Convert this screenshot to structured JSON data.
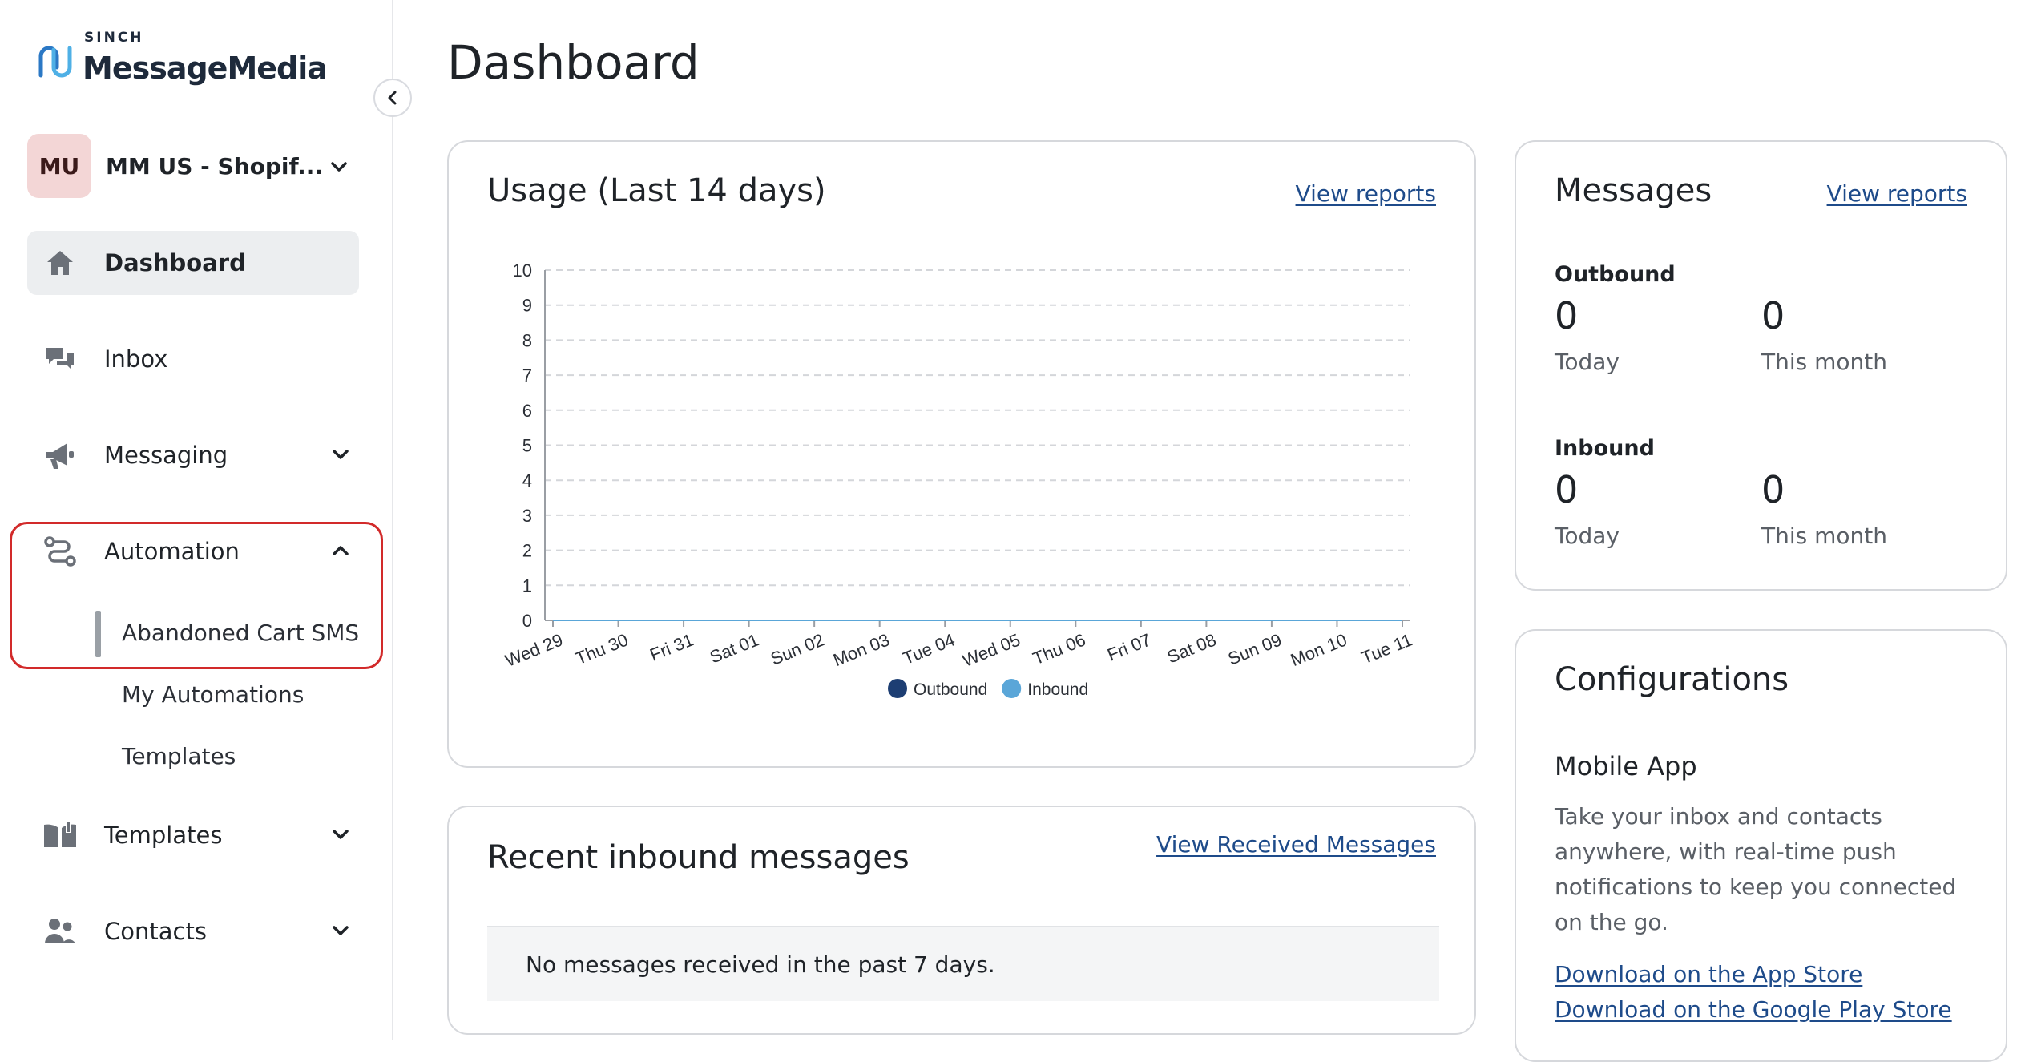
{
  "brand": {
    "small": "SINCH",
    "main": "MessageMedia"
  },
  "account": {
    "initials": "MU",
    "name": "MM US - Shopif..."
  },
  "nav": {
    "dashboard": "Dashboard",
    "inbox": "Inbox",
    "messaging": "Messaging",
    "automation": "Automation",
    "automation_sub": [
      "Abandoned Cart SMS",
      "My Automations",
      "Templates"
    ],
    "templates": "Templates",
    "contacts": "Contacts"
  },
  "page_title": "Dashboard",
  "usage": {
    "title": "Usage (Last 14 days)",
    "view_reports": "View reports"
  },
  "chart_data": {
    "type": "line",
    "categories": [
      "Wed 29",
      "Thu 30",
      "Fri 31",
      "Sat 01",
      "Sun 02",
      "Mon 03",
      "Tue 04",
      "Wed 05",
      "Thu 06",
      "Fri 07",
      "Sat 08",
      "Sun 09",
      "Mon 10",
      "Tue 11"
    ],
    "series": [
      {
        "name": "Outbound",
        "color": "#1d3e73",
        "values": [
          0,
          0,
          0,
          0,
          0,
          0,
          0,
          0,
          0,
          0,
          0,
          0,
          0,
          0
        ]
      },
      {
        "name": "Inbound",
        "color": "#5aa6d8",
        "values": [
          0,
          0,
          0,
          0,
          0,
          0,
          0,
          0,
          0,
          0,
          0,
          0,
          0,
          0
        ]
      }
    ],
    "yticks": [
      0,
      1,
      2,
      3,
      4,
      5,
      6,
      7,
      8,
      9,
      10
    ],
    "ylim": [
      0,
      10
    ],
    "grid": true,
    "legend": "bottom-center"
  },
  "inbound": {
    "title": "Recent inbound messages",
    "link": "View Received Messages",
    "empty": "No messages received in the past 7 days."
  },
  "messages": {
    "title": "Messages",
    "view_reports": "View reports",
    "outbound": {
      "heading": "Outbound",
      "today_value": "0",
      "today_label": "Today",
      "month_value": "0",
      "month_label": "This month"
    },
    "inbound": {
      "heading": "Inbound",
      "today_value": "0",
      "today_label": "Today",
      "month_value": "0",
      "month_label": "This month"
    }
  },
  "config": {
    "title": "Configurations",
    "subtitle": "Mobile App",
    "description": "Take your inbox and contacts anywhere, with real-time push notifications to keep you connected on the go.",
    "app_store": "Download on the App Store",
    "play_store": "Download on the Google Play Store"
  }
}
